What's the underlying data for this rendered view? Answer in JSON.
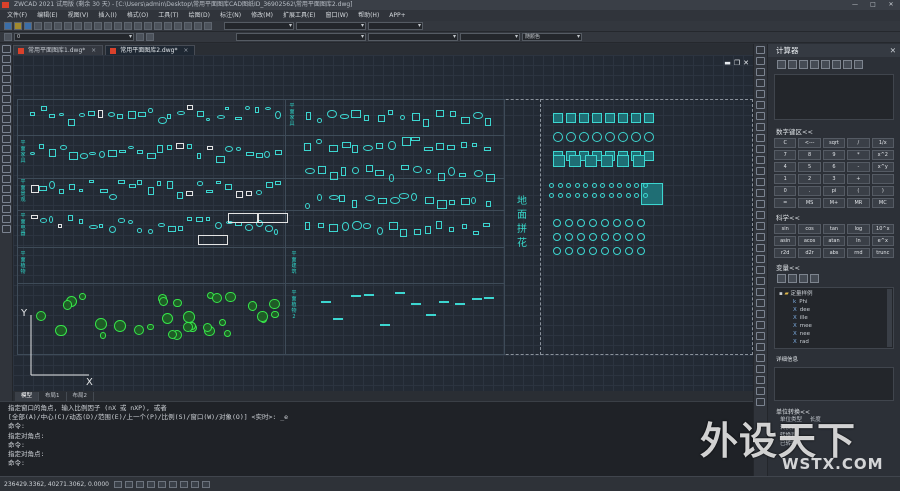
{
  "window": {
    "title": "ZWCAD 2021 试用版 (剩余 30 天) - [C:\\Users\\admin\\Desktop\\常用平面图库CAD图纸ID_36902562\\常用平面图库2.dwg]",
    "min": "—",
    "max": "□",
    "close": "✕"
  },
  "menu": [
    "文件(F)",
    "编辑(E)",
    "视图(V)",
    "插入(I)",
    "格式(O)",
    "工具(T)",
    "绘图(D)",
    "标注(N)",
    "修改(M)",
    "扩展工具(E)",
    "窗口(W)",
    "帮助(H)",
    "APP+"
  ],
  "toolbar": {
    "layer_label": "0",
    "color_label": "随颜色"
  },
  "doc_tabs": [
    {
      "label": "常用平面图库1.dwg*",
      "close": "×"
    },
    {
      "label": "常用平面图库2.dwg*",
      "close": "×"
    }
  ],
  "viewport_controls": {
    "min": "▬",
    "restore": "❐",
    "close": "✕"
  },
  "drawing": {
    "labels_left": [
      "平面家具",
      "平面景观",
      "平面电器",
      "平面植物",
      "平面建筑",
      "平面植物2"
    ],
    "label_middle": "平面家具",
    "floor_label": "地面拼花",
    "ucs_x": "X",
    "ucs_y": "Y"
  },
  "layout_tabs": [
    "模型",
    "布局1",
    "布局2"
  ],
  "command_lines": [
    "指定窗口的角点, 输入比例因子 (nX 或 nXP), 或者",
    "[全部(A)/中心(C)/动态(D)/范围(E)/上一个(P)/比例(S)/窗口(W)/对象(O)] <实时>: _e",
    "命令:",
    "指定对角点:",
    "命令:",
    "指定对角点:",
    "命令:"
  ],
  "status": {
    "coords": "236429.3362, 40271.3062, 0.0000"
  },
  "calculator": {
    "title": "计算器",
    "close": "✕",
    "numpad_title": "数字键区<<",
    "numpad": [
      "C",
      "<---",
      "sqrt",
      "/",
      "1/x",
      "7",
      "8",
      "9",
      "*",
      "x^2",
      "4",
      "5",
      "6",
      "-",
      "x^y",
      "1",
      "2",
      "3",
      "+",
      "",
      "0",
      ".",
      "pi",
      "(",
      ")",
      "=",
      "MS",
      "M+",
      "MR",
      "MC"
    ],
    "sci_title": "科学<<",
    "sci": [
      "sin",
      "cos",
      "tan",
      "log",
      "10^x",
      "asin",
      "acos",
      "atan",
      "ln",
      "e^x",
      "r2d",
      "d2r",
      "abs",
      "rnd",
      "trunc"
    ],
    "vars_title": "变量<<",
    "var_root": "定量样例",
    "vars": [
      {
        "k": "k",
        "name": "Phi"
      },
      {
        "k": "X",
        "name": "dee"
      },
      {
        "k": "X",
        "name": "ille"
      },
      {
        "k": "X",
        "name": "mee"
      },
      {
        "k": "X",
        "name": "nee"
      },
      {
        "k": "X",
        "name": "rad"
      }
    ],
    "detail_title": "详细信息",
    "unit_title": "单位转换<<",
    "unit_rows": [
      "单位类型",
      "转换自",
      "转换到",
      "已转换..."
    ],
    "unit_value": "长度"
  },
  "watermark": {
    "main": "外设天下",
    "site": "WSTX.COM"
  }
}
